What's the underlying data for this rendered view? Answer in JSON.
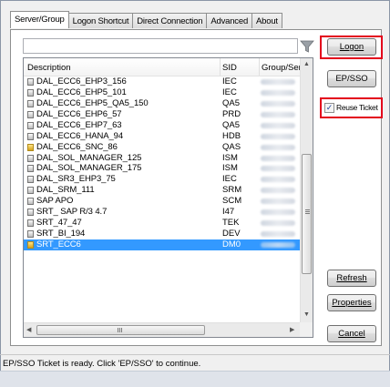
{
  "tabs": [
    {
      "label": "Server/Group",
      "active": true
    },
    {
      "label": "Logon Shortcut",
      "active": false
    },
    {
      "label": "Direct Connection",
      "active": false
    },
    {
      "label": "Advanced",
      "active": false
    },
    {
      "label": "About",
      "active": false
    }
  ],
  "filter": {
    "value": "",
    "icon": "filter-funnel-icon"
  },
  "columns": {
    "description": "Description",
    "sid": "SID",
    "group": "Group/Serv"
  },
  "rows": [
    {
      "description": "DAL_ECC6_EHP3_156",
      "sid": "IEC",
      "icon": "server-icon"
    },
    {
      "description": "DAL_ECC6_EHP5_101",
      "sid": "IEC",
      "icon": "server-icon"
    },
    {
      "description": "DAL_ECC6_EHP5_QA5_150",
      "sid": "QA5",
      "icon": "server-icon"
    },
    {
      "description": "DAL_ECC6_EHP6_57",
      "sid": "PRD",
      "icon": "server-icon"
    },
    {
      "description": "DAL_ECC6_EHP7_63",
      "sid": "QA5",
      "icon": "server-icon"
    },
    {
      "description": "DAL_ECC6_HANA_94",
      "sid": "HDB",
      "icon": "server-icon"
    },
    {
      "description": "DAL_ECC6_SNC_86",
      "sid": "QAS",
      "icon": "key-server-icon"
    },
    {
      "description": "DAL_SOL_MANAGER_125",
      "sid": "ISM",
      "icon": "server-icon"
    },
    {
      "description": "DAL_SOL_MANAGER_175",
      "sid": "ISM",
      "icon": "server-icon"
    },
    {
      "description": "DAL_SR3_EHP3_75",
      "sid": "IEC",
      "icon": "server-icon"
    },
    {
      "description": "DAL_SRM_111",
      "sid": "SRM",
      "icon": "server-icon"
    },
    {
      "description": "SAP APO",
      "sid": "SCM",
      "icon": "server-icon"
    },
    {
      "description": "SRT_ SAP R/3 4.7",
      "sid": "I47",
      "icon": "server-icon"
    },
    {
      "description": "SRT_47_47",
      "sid": "TEK",
      "icon": "server-icon"
    },
    {
      "description": "SRT_BI_194",
      "sid": "DEV",
      "icon": "server-icon"
    },
    {
      "description": "SRT_ECC6",
      "sid": "DM0",
      "icon": "key-server-icon",
      "selected": true
    }
  ],
  "buttons": {
    "logon": "Logon",
    "ep_sso": "EP/SSO",
    "refresh": "Refresh",
    "properties": "Properties",
    "cancel": "Cancel"
  },
  "reuse_ticket": {
    "label": "Reuse Ticket",
    "checked": true
  },
  "status_text": "EP/SSO Ticket is ready. Click 'EP/SSO' to continue.",
  "colors": {
    "highlight": "#e3001b",
    "selection": "#3399ff"
  }
}
